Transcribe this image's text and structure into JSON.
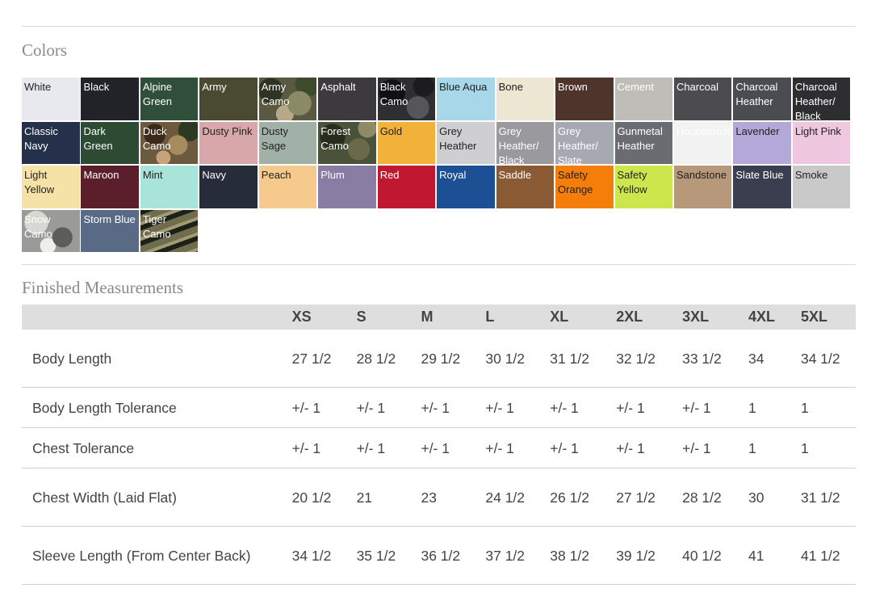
{
  "colors_section": {
    "title": "Colors",
    "swatches": [
      {
        "label": "White",
        "bg": "#e8e9ee",
        "fg": "#222222"
      },
      {
        "label": "Black",
        "bg": "#222328",
        "fg": "#ffffff"
      },
      {
        "label": "Alpine Green",
        "bg": "#2f4f3b",
        "fg": "#ffffff"
      },
      {
        "label": "Army",
        "bg": "#4a4a33",
        "fg": "#ffffff"
      },
      {
        "label": "Army Camo",
        "bg": "#5a5a40",
        "fg": "#ffffff",
        "pattern": "camo-army"
      },
      {
        "label": "Asphalt",
        "bg": "#3d3a3d",
        "fg": "#ffffff"
      },
      {
        "label": "Black Camo",
        "bg": "#2f2f32",
        "fg": "#ffffff",
        "pattern": "camo-dark"
      },
      {
        "label": "Blue Aqua",
        "bg": "#a8d7ea",
        "fg": "#222222"
      },
      {
        "label": "Bone",
        "bg": "#ece6d3",
        "fg": "#222222"
      },
      {
        "label": "Brown",
        "bg": "#4e342b",
        "fg": "#ffffff"
      },
      {
        "label": "Cement",
        "bg": "#bfbdb8",
        "fg": "#ffffff"
      },
      {
        "label": "Charcoal",
        "bg": "#4b4b50",
        "fg": "#ffffff"
      },
      {
        "label": "Charcoal Heather",
        "bg": "#4a4c52",
        "fg": "#ffffff"
      },
      {
        "label": "Charcoal Heather/ Black",
        "bg": "#2e2e31",
        "fg": "#ffffff"
      },
      {
        "label": "Classic Navy",
        "bg": "#25304a",
        "fg": "#ffffff"
      },
      {
        "label": "Dark Green",
        "bg": "#2e4a33",
        "fg": "#ffffff"
      },
      {
        "label": "Duck Camo",
        "bg": "#6b5a3e",
        "fg": "#ffffff",
        "pattern": "camo-duck"
      },
      {
        "label": "Dusty Pink",
        "bg": "#d8a7a9",
        "fg": "#222222"
      },
      {
        "label": "Dusty Sage",
        "bg": "#a2b1a8",
        "fg": "#222222"
      },
      {
        "label": "Forest Camo",
        "bg": "#4a523a",
        "fg": "#ffffff",
        "pattern": "camo-forest"
      },
      {
        "label": "Gold",
        "bg": "#f2b23a",
        "fg": "#222222"
      },
      {
        "label": "Grey Heather",
        "bg": "#cfcfd2",
        "fg": "#222222"
      },
      {
        "label": "Grey Heather/ Black",
        "bg": "#9a9a9e",
        "fg": "#ffffff"
      },
      {
        "label": "Grey Heather/ Slate",
        "bg": "#a7a9b2",
        "fg": "#ffffff"
      },
      {
        "label": "Gunmetal Heather",
        "bg": "#6a6c72",
        "fg": "#ffffff"
      },
      {
        "label": "Houndstooth",
        "bg": "#f2f2f2",
        "fg": "#ffffff",
        "pattern": "houndstooth"
      },
      {
        "label": "Lavender",
        "bg": "#b3a8d8",
        "fg": "#222222"
      },
      {
        "label": "Light Pink",
        "bg": "#efc7de",
        "fg": "#222222"
      },
      {
        "label": "Light Yellow",
        "bg": "#f5e2a6",
        "fg": "#222222"
      },
      {
        "label": "Maroon",
        "bg": "#5a1f2a",
        "fg": "#ffffff"
      },
      {
        "label": "Mint",
        "bg": "#a9e4db",
        "fg": "#222222"
      },
      {
        "label": "Navy",
        "bg": "#272c3a",
        "fg": "#ffffff"
      },
      {
        "label": "Peach",
        "bg": "#f6c98c",
        "fg": "#222222"
      },
      {
        "label": "Plum",
        "bg": "#8a7da3",
        "fg": "#ffffff"
      },
      {
        "label": "Red",
        "bg": "#c0182f",
        "fg": "#ffffff"
      },
      {
        "label": "Royal",
        "bg": "#1c4f94",
        "fg": "#ffffff"
      },
      {
        "label": "Saddle",
        "bg": "#8a5a34",
        "fg": "#ffffff"
      },
      {
        "label": "Safety Orange",
        "bg": "#f57e0b",
        "fg": "#222222"
      },
      {
        "label": "Safety Yellow",
        "bg": "#cde64c",
        "fg": "#222222"
      },
      {
        "label": "Sandstone",
        "bg": "#b8987a",
        "fg": "#222222"
      },
      {
        "label": "Slate Blue",
        "bg": "#3a3e4e",
        "fg": "#ffffff"
      },
      {
        "label": "Smoke",
        "bg": "#c9c9c9",
        "fg": "#222222"
      },
      {
        "label": "Snow Camo",
        "bg": "#9a9a98",
        "fg": "#ffffff",
        "pattern": "camo-snow"
      },
      {
        "label": "Storm Blue",
        "bg": "#586a86",
        "fg": "#ffffff"
      },
      {
        "label": "Tiger Camo",
        "bg": "#5b5b44",
        "fg": "#ffffff",
        "pattern": "camo-tiger"
      }
    ]
  },
  "measurements_section": {
    "title": "Finished Measurements",
    "columns": [
      "",
      "XS",
      "S",
      "M",
      "L",
      "XL",
      "2XL",
      "3XL",
      "4XL",
      "5XL"
    ],
    "rows": [
      {
        "label": "Body Length",
        "values": [
          "27 1/2",
          "28 1/2",
          "29 1/2",
          "30 1/2",
          "31 1/2",
          "32 1/2",
          "33 1/2",
          "34",
          "34 1/2"
        ]
      },
      {
        "label": "Body Length Tolerance",
        "values": [
          "+/- 1",
          "+/- 1",
          "+/- 1",
          "+/- 1",
          "+/- 1",
          "+/- 1",
          "+/- 1",
          "1",
          "1"
        ]
      },
      {
        "label": "Chest Tolerance",
        "values": [
          "+/- 1",
          "+/- 1",
          "+/- 1",
          "+/- 1",
          "+/- 1",
          "+/- 1",
          "+/- 1",
          "1",
          "1"
        ]
      },
      {
        "label": "Chest Width (Laid Flat)",
        "values": [
          "20 1/2",
          "21",
          "23",
          "24 1/2",
          "26 1/2",
          "27 1/2",
          "28 1/2",
          "30",
          "31 1/2"
        ]
      },
      {
        "label": "Sleeve Length (From Center Back)",
        "values": [
          "34 1/2",
          "35 1/2",
          "36 1/2",
          "37 1/2",
          "38 1/2",
          "39 1/2",
          "40 1/2",
          "41",
          "41 1/2"
        ]
      }
    ]
  }
}
